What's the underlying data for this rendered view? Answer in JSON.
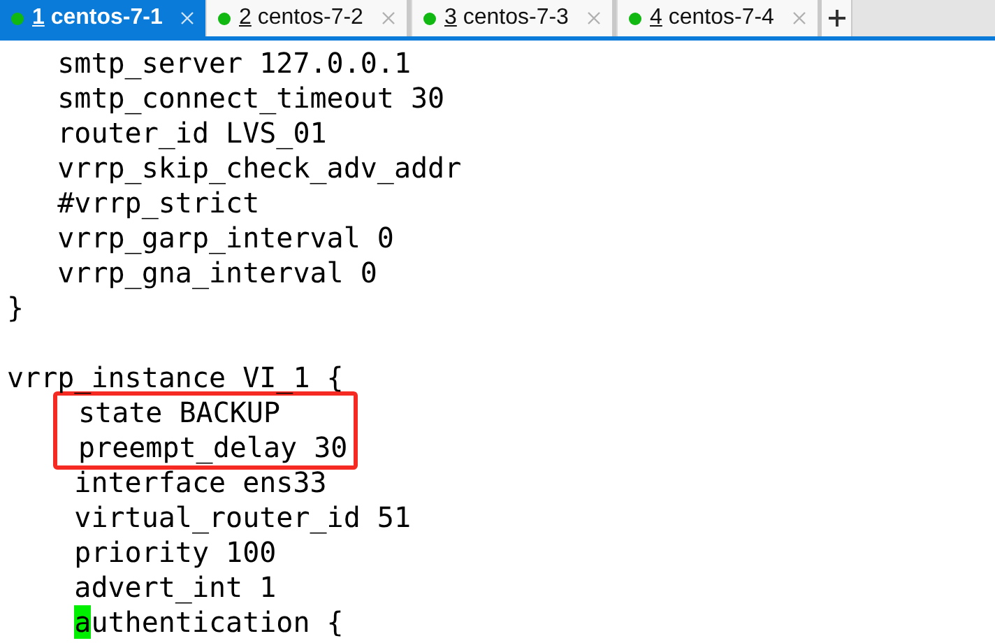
{
  "tabs": [
    {
      "number": "1",
      "label": "centos-7-1",
      "selected": true
    },
    {
      "number": "2",
      "label": "centos-7-2",
      "selected": false
    },
    {
      "number": "3",
      "label": "centos-7-3",
      "selected": false
    },
    {
      "number": "4",
      "label": "centos-7-4",
      "selected": false
    }
  ],
  "terminal": {
    "lines": [
      {
        "kind": "line",
        "text": "   smtp_server 127.0.0.1"
      },
      {
        "kind": "line",
        "text": "   smtp_connect_timeout 30"
      },
      {
        "kind": "line",
        "text": "   router_id LVS_01"
      },
      {
        "kind": "line",
        "text": "   vrrp_skip_check_adv_addr"
      },
      {
        "kind": "line",
        "text": "   #vrrp_strict"
      },
      {
        "kind": "line",
        "text": "   vrrp_garp_interval 0"
      },
      {
        "kind": "line",
        "text": "   vrrp_gna_interval 0"
      },
      {
        "kind": "line",
        "text": "}"
      },
      {
        "kind": "blank"
      },
      {
        "kind": "line",
        "text": "vrrp_instance VI_1 {"
      },
      {
        "kind": "boxed",
        "children": [
          {
            "kind": "line",
            "text": "state BACKUP"
          },
          {
            "kind": "line",
            "text": "preempt_delay 30"
          }
        ]
      },
      {
        "kind": "line",
        "text": "    interface ens33"
      },
      {
        "kind": "line",
        "text": "    virtual_router_id 51"
      },
      {
        "kind": "line",
        "text": "    priority 100"
      },
      {
        "kind": "line",
        "text": "    advert_int 1"
      },
      {
        "kind": "line",
        "text": "    authentication {",
        "cursor": true
      }
    ]
  }
}
